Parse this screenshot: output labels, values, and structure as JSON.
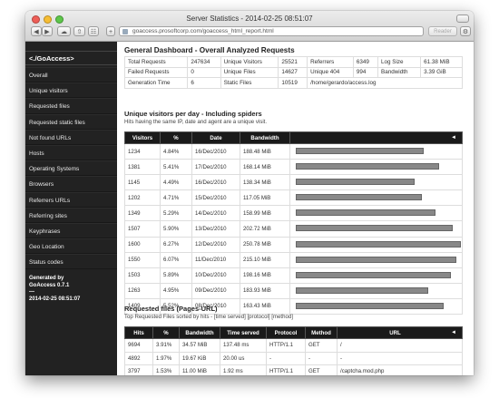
{
  "window": {
    "title": "Server Statistics - 2014-02-25 08:51:07"
  },
  "toolbar": {
    "url": "goaccess.prosoftcorp.com/goaccess_html_report.html",
    "reader_label": "Reader",
    "back_icon": "back-arrow",
    "forward_icon": "forward-arrow"
  },
  "sidebar": {
    "brand": "<./GoAccess>",
    "items": [
      "Overall",
      "Unique visitors",
      "Requested files",
      "Requested static files",
      "Not found URLs",
      "Hosts",
      "Operating Systems",
      "Browsers",
      "Referrers URLs",
      "Referring sites",
      "Keyphrases",
      "Geo Location",
      "Status codes"
    ],
    "footer": [
      "Generated by",
      "GoAccess 0.7.1",
      "—",
      "2014-02-25 08:51:07"
    ]
  },
  "general": {
    "title": "General Dashboard - Overall Analyzed Requests",
    "rows": [
      [
        "Total Requests",
        "247634",
        "Unique Visitors",
        "25521",
        "Referrers",
        "6349",
        "Log Size",
        "61.38 MiB"
      ],
      [
        "Failed Requests",
        "0",
        "Unique Files",
        "14627",
        "Unique 404",
        "994",
        "Bandwidth",
        "3.39 GiB"
      ],
      [
        "Generation Time",
        "6",
        "Static Files",
        "10519",
        "/home/gerardo/access.log",
        "",
        "",
        ""
      ]
    ]
  },
  "visitors": {
    "title": "Unique visitors per day - Including spiders",
    "subtitle": "Hits having the same IP, date and agent are a unique visit.",
    "headers": [
      "Visitors",
      "%",
      "Date",
      "Bandwidth"
    ],
    "caret": "◄",
    "rows": [
      {
        "visitors": "1234",
        "pct": "4.84%",
        "date": "16/Dec/2010",
        "bandwidth": "188.48 MiB",
        "share": 0.74
      },
      {
        "visitors": "1381",
        "pct": "5.41%",
        "date": "17/Dec/2010",
        "bandwidth": "168.14 MiB",
        "share": 0.83
      },
      {
        "visitors": "1145",
        "pct": "4.49%",
        "date": "16/Dec/2010",
        "bandwidth": "138.34 MiB",
        "share": 0.69
      },
      {
        "visitors": "1202",
        "pct": "4.71%",
        "date": "15/Dec/2010",
        "bandwidth": "117.05 MiB",
        "share": 0.73
      },
      {
        "visitors": "1349",
        "pct": "5.29%",
        "date": "14/Dec/2010",
        "bandwidth": "158.99 MiB",
        "share": 0.81
      },
      {
        "visitors": "1507",
        "pct": "5.90%",
        "date": "13/Dec/2010",
        "bandwidth": "202.72 MiB",
        "share": 0.91
      },
      {
        "visitors": "1600",
        "pct": "6.27%",
        "date": "12/Dec/2010",
        "bandwidth": "250.78 MiB",
        "share": 0.96
      },
      {
        "visitors": "1550",
        "pct": "6.07%",
        "date": "11/Dec/2010",
        "bandwidth": "215.10 MiB",
        "share": 0.93
      },
      {
        "visitors": "1503",
        "pct": "5.89%",
        "date": "10/Dec/2010",
        "bandwidth": "198.16 MiB",
        "share": 0.9
      },
      {
        "visitors": "1263",
        "pct": "4.95%",
        "date": "09/Dec/2010",
        "bandwidth": "183.93 MiB",
        "share": 0.77
      },
      {
        "visitors": "1409",
        "pct": "5.52%",
        "date": "08/Dec/2010",
        "bandwidth": "163.43 MiB",
        "share": 0.86
      }
    ]
  },
  "requests": {
    "title": "Requested files (Pages-URL)",
    "subtitle": "Top Requested Files sorted by hits - [time served] [protocol] [method]",
    "headers": [
      "Hits",
      "%",
      "Bandwidth",
      "Time served",
      "Protocol",
      "Method",
      "URL"
    ],
    "caret": "◄",
    "rows": [
      [
        "9694",
        "3.91%",
        "34.57 MiB",
        "137.48 ms",
        "HTTP/1.1",
        "GET",
        "/"
      ],
      [
        "4892",
        "1.97%",
        "19.67 KiB",
        "20.00 us",
        "-",
        "-",
        "-"
      ],
      [
        "3797",
        "1.53%",
        "11.00 MiB",
        "1.92 ms",
        "HTTP/1.1",
        "GET",
        "/captcha.mod.php"
      ]
    ]
  }
}
